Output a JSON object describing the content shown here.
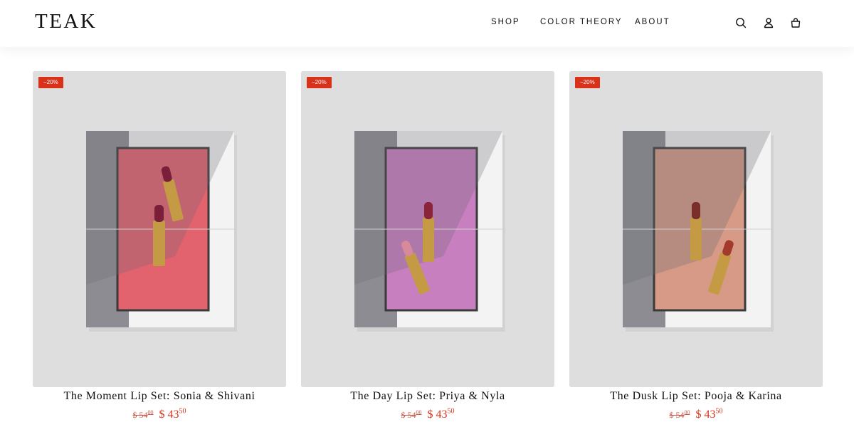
{
  "brand": {
    "logo": "TEAK"
  },
  "nav": {
    "shop": "SHOP",
    "color_theory": "COLOR THEORY",
    "about": "ABOUT"
  },
  "icons": {
    "search": "search-icon",
    "account": "user-icon",
    "cart": "bag-icon"
  },
  "colors": {
    "accent": "#d8321a",
    "card_bg": "#dedede"
  },
  "products": [
    {
      "badge": "−20%",
      "title": "The Moment Lip Set: Sonia & Shivani",
      "old_currency": "$",
      "old_whole": "54",
      "old_cents": "00",
      "new_currency": "$",
      "new_whole": "43",
      "new_cents": "50"
    },
    {
      "badge": "−20%",
      "title": "The Day Lip Set: Priya & Nyla",
      "old_currency": "$",
      "old_whole": "54",
      "old_cents": "00",
      "new_currency": "$",
      "new_whole": "43",
      "new_cents": "50"
    },
    {
      "badge": "−20%",
      "title": "The Dusk Lip Set: Pooja & Karina",
      "old_currency": "$",
      "old_whole": "54",
      "old_cents": "00",
      "new_currency": "$",
      "new_whole": "43",
      "new_cents": "50"
    }
  ]
}
